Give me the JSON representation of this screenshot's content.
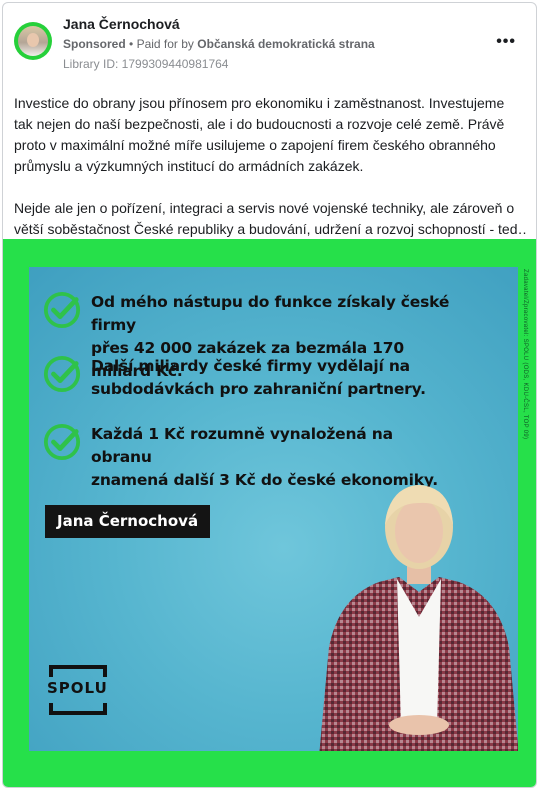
{
  "post": {
    "author": "Jana Černochová",
    "sponsored": "Sponsored",
    "paid_for_prefix": "Paid for by",
    "payer": "Občanská demokratická strana",
    "library_id": "Library ID: 1799309440981764",
    "more_icon": "more-dots-icon",
    "paragraph1": "Investice do obrany jsou přínosem pro ekonomiku i zaměstnanost. Investujeme tak nejen do naší bezpečnosti, ale i do budoucnosti a rozvoje celé země. Právě proto v maximální možné míře usilujeme o zapojení firem českého obranného průmyslu a výzkumných institucí do armádních zakázek.",
    "paragraph2_line1": "Nejde ale jen o pořízení, integraci a servis nové vojenské techniky, ale zároveň o",
    "paragraph2_line2": "větší soběstačnost České republiky a budování, udržení a rozvoj schopností - ted…"
  },
  "ad_creative": {
    "bullets": [
      {
        "icon": "check-circle-icon",
        "line1": "Od mého nástupu do funkce získaly české firmy",
        "line2": "přes 42 000 zakázek za bezmála 170 miliard Kč."
      },
      {
        "icon": "check-circle-icon",
        "line1": "Další miliardy české firmy vydělají na",
        "line2": "subdodávkách pro zahraniční partnery."
      },
      {
        "icon": "check-circle-icon",
        "line1": "Každá 1 Kč rozumně vynaložená na obranu",
        "line2": "znamená další 3 Kč do české ekonomiky."
      }
    ],
    "name_label": "Jana Černochová",
    "logo_text": "SPOLU",
    "disclaimer": "Zadavatel/Zpracovatel: SPOLU (ODS, KDU-ČSL, TOP 09)",
    "colors": {
      "frame_green": "#26e04a",
      "poster_blue": "#56b5cf",
      "check_green": "#2fc24a",
      "text_dark": "#111111"
    }
  }
}
